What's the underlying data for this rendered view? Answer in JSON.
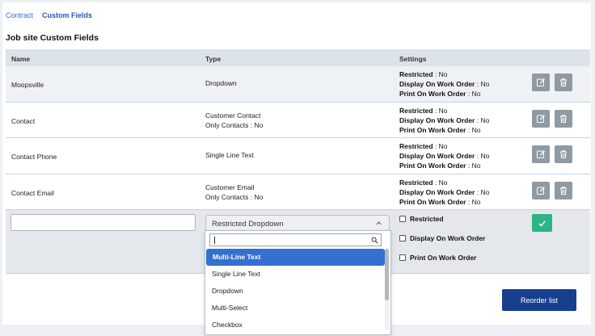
{
  "tabs": [
    "Contract",
    "Custom Fields"
  ],
  "section_title": "Job site Custom Fields",
  "columns": {
    "name": "Name",
    "type": "Type",
    "settings": "Settings"
  },
  "settings_labels": {
    "restricted": "Restricted",
    "display": "Display On Work Order",
    "print": "Print On Work Order"
  },
  "rows": [
    {
      "name": "Moopsville",
      "type": "Dropdown",
      "type_sub": "",
      "restricted": " : No",
      "display": " : No",
      "print": " : No"
    },
    {
      "name": "Contact",
      "type": "Customer Contact",
      "type_sub": "Only Contacts : No",
      "restricted": " : No",
      "display": " : No",
      "print": " : No"
    },
    {
      "name": "Contact Phone",
      "type": "Single Line Text",
      "type_sub": "",
      "restricted": " : No",
      "display": " : No",
      "print": " : No"
    },
    {
      "name": "Contact Email",
      "type": "Customer Email",
      "type_sub": "Only Contacts : No",
      "restricted": " : No",
      "display": " : No",
      "print": " : No"
    }
  ],
  "edit_row": {
    "name_value": "",
    "type_selected": "Restricted Dropdown",
    "checkboxes": [
      "Restricted",
      "Display On Work Order",
      "Print On Work Order"
    ]
  },
  "dropdown": {
    "search_value": "",
    "options": [
      "Multi-Line Text",
      "Single Line Text",
      "Dropdown",
      "Multi-Select",
      "Checkbox"
    ],
    "highlighted": "Multi-Line Text"
  },
  "reorder_label": "Reorder list",
  "colors": {
    "accent": "#3470cf",
    "primary_button": "#173f8e",
    "save_button": "#2bb583",
    "icon_button": "#8f9aa3"
  }
}
